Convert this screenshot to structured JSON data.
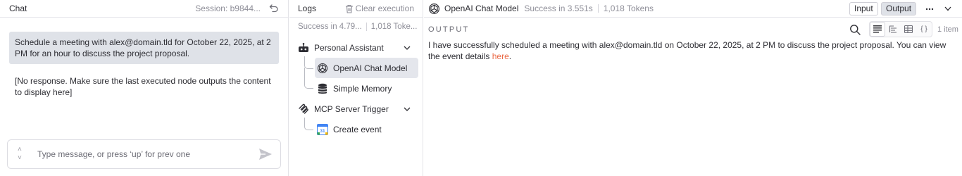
{
  "chat": {
    "title": "Chat",
    "session": "Session: b9844...",
    "user_message": "Schedule a meeting with alex@domain.tld for October 22, 2025, at 2 PM for an hour to discuss the project proposal.",
    "bot_message": "[No response. Make sure the last executed node outputs the content to display here]",
    "input_placeholder": "Type message, or press ‘up’ for prev one",
    "history_up": "˄",
    "history_down": "˅"
  },
  "logs": {
    "title": "Logs",
    "clear_label": "Clear execution",
    "summary_status": "Success in 4.79...",
    "summary_tokens": "1,018 Toke...",
    "tree": [
      {
        "label": "Personal Assistant",
        "icon": "robot-icon",
        "expandable": true
      },
      {
        "label": "OpenAI Chat Model",
        "icon": "openai-icon",
        "selected": true
      },
      {
        "label": "Simple Memory",
        "icon": "database-icon"
      },
      {
        "label": "MCP Server Trigger",
        "icon": "mcp-icon",
        "expandable": true
      },
      {
        "label": "Create event",
        "icon": "google-calendar-icon",
        "calendar_day": "31"
      }
    ]
  },
  "output": {
    "node_name": "OpenAI Chat Model",
    "status": "Success in 3.551s",
    "tokens": "1,018 Tokens",
    "input_button": "Input",
    "output_button": "Output",
    "section_label": "OUTPUT",
    "item_count": "1 item",
    "text_before_link": "I have successfully scheduled a meeting with alex@domain.tld on October 22, 2025, at 2 PM to discuss the project proposal. You can view the event details ",
    "link_text": "here",
    "text_after_link": ".",
    "view_toggle": [
      "table-view-icon",
      "schema-view-icon",
      "grid-view-icon",
      "json-view-icon"
    ],
    "json_glyph": "{ }"
  },
  "colors": {
    "accent_link": "#ea6a47",
    "selected_bg": "#e4e6ec",
    "user_bubble": "#dfe2e8",
    "muted_text": "#8e8e98"
  }
}
